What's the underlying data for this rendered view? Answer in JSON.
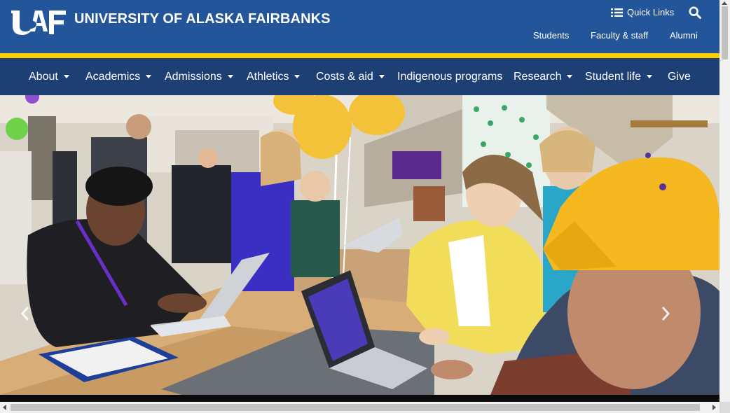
{
  "header": {
    "logo_text": "UAF",
    "title": "UNIVERSITY OF ALASKA FAIRBANKS",
    "quick_links_label": "Quick Links",
    "audience_links": [
      "Students",
      "Faculty & staff",
      "Alumni"
    ]
  },
  "nav": {
    "items": [
      {
        "label": "About",
        "dropdown": true
      },
      {
        "label": "Academics",
        "dropdown": true
      },
      {
        "label": "Admissions",
        "dropdown": true
      },
      {
        "label": "Athletics",
        "dropdown": true
      },
      {
        "label": "Costs & aid",
        "dropdown": true
      },
      {
        "label": "Indigenous programs",
        "dropdown": false
      },
      {
        "label": "Research",
        "dropdown": true
      },
      {
        "label": "Student life",
        "dropdown": true
      },
      {
        "label": "Give",
        "dropdown": false
      }
    ]
  },
  "hero": {
    "prev_icon": "chevron-left-icon",
    "next_icon": "chevron-right-icon"
  },
  "colors": {
    "header_blue": "#23559a",
    "nav_blue": "#1e3f73",
    "accent_gold": "#ffcd00"
  }
}
